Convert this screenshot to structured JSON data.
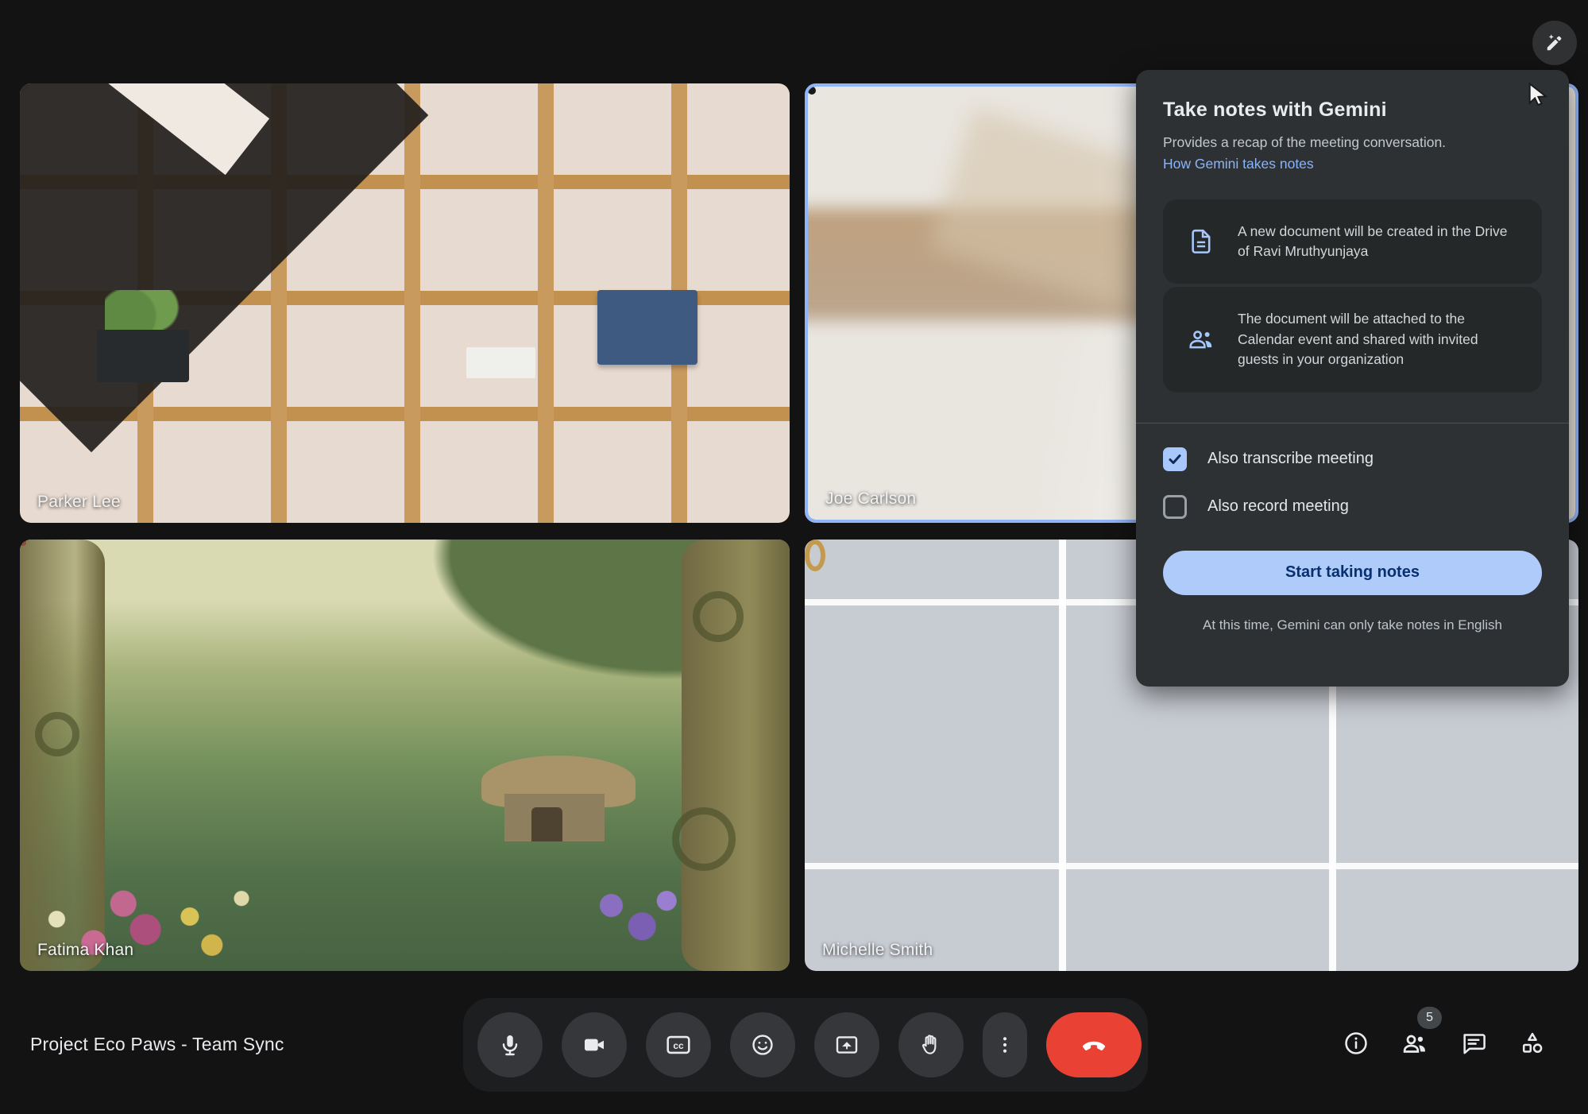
{
  "meeting": {
    "title": "Project Eco Paws - Team Sync"
  },
  "participants": [
    {
      "name": "Parker Lee",
      "speaking": false
    },
    {
      "name": "Joe Carlson",
      "speaking": true
    },
    {
      "name": "Fatima Khan",
      "speaking": false
    },
    {
      "name": "Michelle Smith",
      "speaking": false
    }
  ],
  "gemini_panel": {
    "title": "Take notes with Gemini",
    "description": "Provides a recap of the meeting conversation.",
    "link": "How Gemini takes notes",
    "info_cards": [
      {
        "icon": "document-icon",
        "text": "A new document will be created in the Drive of Ravi Mruthyunjaya"
      },
      {
        "icon": "people-share-icon",
        "text": "The document will be attached to the Calendar event and shared with invited guests in your organization"
      }
    ],
    "options": [
      {
        "label": "Also transcribe meeting",
        "checked": true
      },
      {
        "label": "Also record meeting",
        "checked": false
      }
    ],
    "primary_button": "Start taking notes",
    "footnote": "At this time, Gemini can only take notes in English"
  },
  "toolbar": {
    "left_controls": [
      "microphone",
      "camera",
      "captions",
      "reactions",
      "present-screen",
      "raise-hand",
      "more-options",
      "end-call"
    ],
    "right_controls": [
      "meeting-details",
      "people",
      "chat",
      "activities"
    ],
    "participants_badge": "5"
  },
  "icons": {
    "captions_glyph": "cc"
  },
  "colors": {
    "accent_blue": "#a8c7fa",
    "link_blue": "#8ab4f8",
    "speaking_border": "#90b4f8",
    "end_call_red": "#e94235",
    "panel_bg": "#2d3134",
    "button_text_blue": "#08306e"
  }
}
